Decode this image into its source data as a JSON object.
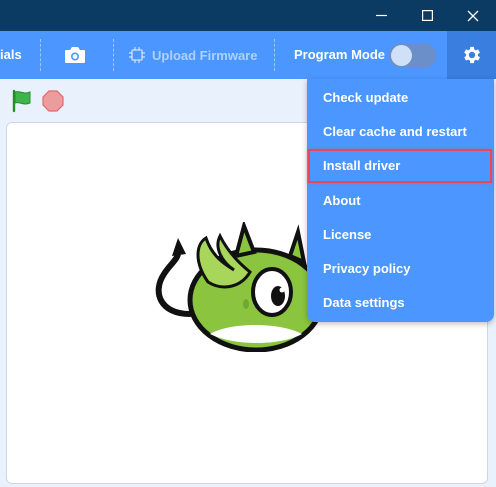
{
  "titlebar": {
    "minimize_icon": "minimize-icon",
    "maximize_icon": "maximize-icon",
    "close_icon": "close-icon"
  },
  "menubar": {
    "tutorials_label": "ials",
    "camera_icon": "camera-icon",
    "upload_firmware_label": "Upload Firmware",
    "upload_firmware_icon": "chip-icon",
    "program_mode_label": "Program Mode",
    "program_mode_on": false,
    "settings_icon": "gear-icon"
  },
  "controls": {
    "green_flag_icon": "green-flag-icon",
    "stop_icon": "stop-icon"
  },
  "settings_menu": {
    "items": [
      {
        "label": "Check update"
      },
      {
        "label": "Clear cache and restart"
      },
      {
        "label": "Install driver",
        "highlighted": true
      },
      {
        "label": "About"
      },
      {
        "label": "License"
      },
      {
        "label": "Privacy policy"
      },
      {
        "label": "Data settings"
      }
    ]
  },
  "colors": {
    "titlebar": "#0b3a63",
    "menubar": "#4c97ff",
    "highlight_border": "#e8475a",
    "sprite_body": "#8bc53f"
  }
}
